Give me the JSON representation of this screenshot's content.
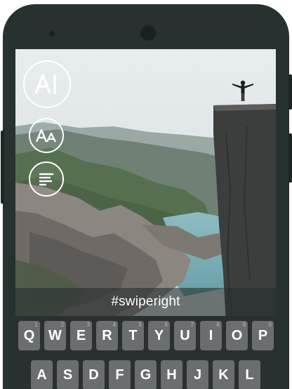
{
  "caption": {
    "text": "#swiperight"
  },
  "tools": {
    "font_icon": "font-style-icon",
    "size_icon": "text-size-icon",
    "align_icon": "text-align-icon"
  },
  "keyboard": {
    "row1": [
      {
        "label": "Q",
        "hint": "1"
      },
      {
        "label": "W",
        "hint": "2"
      },
      {
        "label": "E",
        "hint": "3"
      },
      {
        "label": "R",
        "hint": "4"
      },
      {
        "label": "T",
        "hint": "5"
      },
      {
        "label": "Y",
        "hint": "6"
      },
      {
        "label": "U",
        "hint": "7"
      },
      {
        "label": "I",
        "hint": "8"
      },
      {
        "label": "O",
        "hint": "9"
      },
      {
        "label": "P",
        "hint": "0"
      }
    ],
    "row2": [
      "A",
      "S",
      "D",
      "F",
      "G",
      "H",
      "J",
      "K",
      "L"
    ]
  },
  "colors": {
    "phone_body": "#263130",
    "key_background": "#6b6e6f",
    "keyboard_background": "#2a2f30",
    "sky": "#dfe5e8",
    "cliff": "#3c3f3e",
    "water": "#7fb0b8"
  }
}
